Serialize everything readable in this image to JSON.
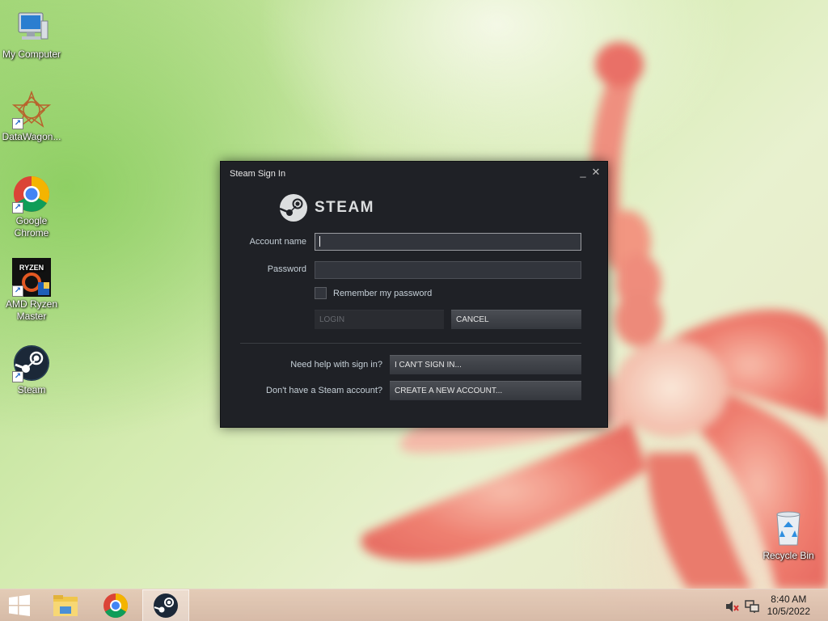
{
  "desktop": {
    "icons": [
      {
        "label": "My Computer",
        "icon": "computer-icon"
      },
      {
        "label": "DataWagon...",
        "icon": "datawagon-icon"
      },
      {
        "label": "Google Chrome",
        "icon": "chrome-icon"
      },
      {
        "label": "AMD Ryzen Master",
        "icon": "ryzen-icon",
        "badge": "RYZEN"
      },
      {
        "label": "Steam",
        "icon": "steam-icon"
      },
      {
        "label": "Recycle Bin",
        "icon": "recycle-bin-icon"
      }
    ]
  },
  "dialog": {
    "title": "Steam Sign In",
    "logo_text": "STEAM",
    "account_label": "Account name",
    "account_value": "",
    "password_label": "Password",
    "password_value": "",
    "remember_label": "Remember my password",
    "remember_checked": false,
    "login_label": "LOGIN",
    "cancel_label": "CANCEL",
    "help_prompt": "Need help with sign in?",
    "cant_sign_in_label": "I CAN'T SIGN IN...",
    "no_account_prompt": "Don't have a Steam account?",
    "create_account_label": "CREATE A NEW ACCOUNT...",
    "minimize_glyph": "_",
    "close_glyph": "✕"
  },
  "taskbar": {
    "items": [
      {
        "name": "start",
        "icon": "windows-icon"
      },
      {
        "name": "file-explorer",
        "icon": "folder-icon"
      },
      {
        "name": "chrome",
        "icon": "chrome-icon"
      },
      {
        "name": "steam",
        "icon": "steam-icon",
        "active": true
      }
    ],
    "tray": {
      "time": "8:40 AM",
      "date": "10/5/2022",
      "volume_icon": "volume-muted-icon",
      "network_icon": "network-icon"
    }
  },
  "colors": {
    "dialog_bg": "#1f2126",
    "button_bg": "#40434a",
    "accent_text": "#c6d0d8"
  }
}
